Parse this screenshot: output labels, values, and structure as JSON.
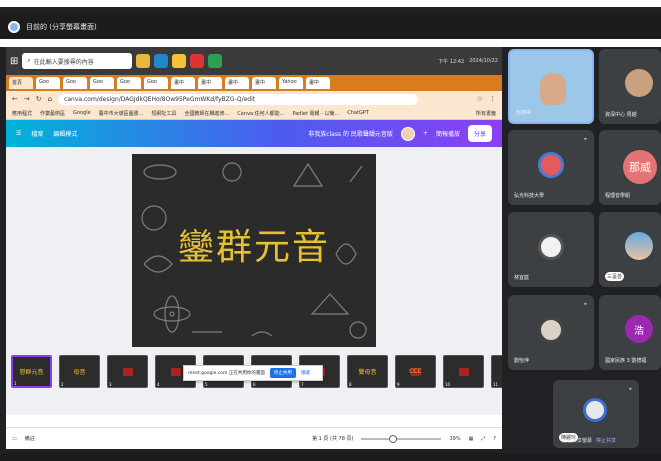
{
  "meet": {
    "title": "目前的 (分享螢幕畫面)"
  },
  "taskbar": {
    "search_placeholder": "在此輸入要搜尋的內容",
    "clock": "下午 12:42",
    "date": "2024/10/22"
  },
  "browser": {
    "tabs": [
      "首頁",
      "Goo",
      "Goo",
      "Goo",
      "Goo",
      "Goo",
      "畫中",
      "畫中",
      "畫中",
      "畫中",
      "Yahoo",
      "畫中"
    ],
    "url": "canva.com/design/DAGJdkQEHo/8Ow95PeGmWKd/fyBZG-Q/edit",
    "bookmarks": [
      "應用程式",
      "作業藝術區",
      "Google",
      "臺中市大墩區圖書...",
      "短網址工具",
      "全國教師在職進修...",
      "Canva:任何人都能...",
      "Padlet 電報 - 以簡...",
      "ChatGPT"
    ],
    "bookmarks_right": "所有書籤"
  },
  "canva": {
    "menu_file": "檔案",
    "menu_edit_mode": "編輯模式",
    "doc_title": "非我族class 的 民歌聲韻元音版",
    "present_label": "簡報播放",
    "share_label": "分享",
    "slide_title": "鑾群元音",
    "thumbs": [
      {
        "num": "1",
        "label": "戀群元音",
        "red": false
      },
      {
        "num": "2",
        "label": "母音",
        "red": false
      },
      {
        "num": "3",
        "label": "",
        "red": true
      },
      {
        "num": "4",
        "label": "",
        "red": true
      },
      {
        "num": "5",
        "label": "",
        "red": true
      },
      {
        "num": "6",
        "label": "",
        "red": true
      },
      {
        "num": "7",
        "label": "",
        "red": true
      },
      {
        "num": "8",
        "label": "雙母音",
        "red": false
      },
      {
        "num": "9",
        "label": "CCC",
        "red": true
      },
      {
        "num": "10",
        "label": "",
        "red": true
      },
      {
        "num": "11",
        "label": "",
        "red": true
      }
    ],
    "notes": "備註",
    "page_info": "第 1 頁 (共 78 頁)",
    "zoom": "39%"
  },
  "toast": {
    "text": "meet.google.com 正在共用你的畫面",
    "stop": "停止共用",
    "hide": "隱藏"
  },
  "participants": [
    {
      "name": "伍陳亭",
      "tile": "p0"
    },
    {
      "name": "資深中心 周越",
      "tile": "p1"
    },
    {
      "name": "弘光科技大學",
      "tile": "p2"
    },
    {
      "name": "那威",
      "tile": "p3",
      "name2": "程理音學組"
    },
    {
      "name": "林宜庭",
      "tile": "p4"
    },
    {
      "name": "三呈芸",
      "tile": "p5"
    },
    {
      "name": "劉怡萍",
      "tile": "p6"
    },
    {
      "name": "國家民族 3 劉禮福",
      "tile": "p7",
      "initial": "浩"
    },
    {
      "name": "陳麗玲",
      "tile": "p8"
    },
    {
      "name": "正在共享螢幕",
      "tile": "p9",
      "name2": "停止共享"
    }
  ]
}
